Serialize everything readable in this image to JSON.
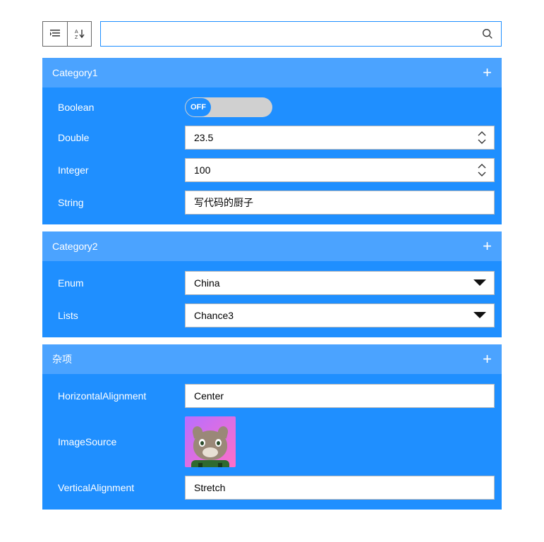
{
  "search": {
    "placeholder": ""
  },
  "categories": [
    {
      "title": "Category1",
      "rows": [
        {
          "label": "Boolean",
          "type": "toggle",
          "value": "OFF"
        },
        {
          "label": "Double",
          "type": "number",
          "value": "23.5"
        },
        {
          "label": "Integer",
          "type": "number",
          "value": "100"
        },
        {
          "label": "String",
          "type": "text",
          "value": "写代码的厨子"
        }
      ]
    },
    {
      "title": "Category2",
      "rows": [
        {
          "label": "Enum",
          "type": "select",
          "value": "China"
        },
        {
          "label": "Lists",
          "type": "select",
          "value": "Chance3"
        }
      ]
    },
    {
      "title": "杂项",
      "rows": [
        {
          "label": "HorizontalAlignment",
          "type": "text",
          "value": "Center"
        },
        {
          "label": "ImageSource",
          "type": "image",
          "value": "cat-avatar"
        },
        {
          "label": "VerticalAlignment",
          "type": "text",
          "value": "Stretch"
        }
      ]
    }
  ],
  "colors": {
    "accent": "#1f8fff",
    "header": "#4ba3ff"
  }
}
